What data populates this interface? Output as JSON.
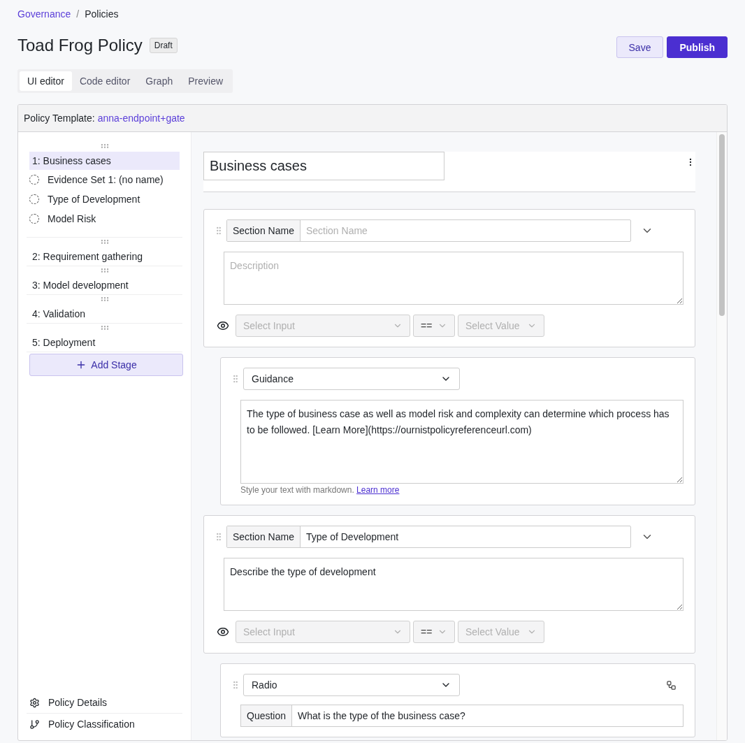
{
  "breadcrumb_separator": "/",
  "breadcrumb": [
    {
      "label": "Governance",
      "link": true
    },
    {
      "label": "Policies",
      "link": false
    }
  ],
  "title": "Toad Frog Policy",
  "status_badge": "Draft",
  "actions": [
    {
      "label": "Save",
      "kind": "secondary"
    },
    {
      "label": "Publish",
      "kind": "primary"
    }
  ],
  "tabs": [
    {
      "label": "UI editor",
      "selected": true
    },
    {
      "label": "Code editor",
      "selected": false
    },
    {
      "label": "Graph",
      "selected": false
    },
    {
      "label": "Preview",
      "selected": false
    }
  ],
  "template": {
    "label": "Policy Template:",
    "value": "anna-endpoint+gate"
  },
  "sidebar": {
    "stages": [
      {
        "label": "1: Business cases",
        "selected": true,
        "children": [
          {
            "label": "Evidence Set 1: (no name)"
          },
          {
            "label": "Type of Development"
          },
          {
            "label": "Model Risk"
          }
        ]
      },
      {
        "label": "2: Requirement gathering",
        "selected": false
      },
      {
        "label": "3: Model development",
        "selected": false
      },
      {
        "label": "4: Validation",
        "selected": false
      },
      {
        "label": "5: Deployment",
        "selected": false
      }
    ],
    "add_button": "Add Stage",
    "footer_links": [
      {
        "label": "Policy Details",
        "kind": "settings"
      },
      {
        "label": "Policy Classification",
        "kind": "branch"
      }
    ]
  },
  "editor": {
    "stage_title": "Business cases",
    "blocks": [
      {
        "kind": "section",
        "name_label": "Section Name",
        "name_placeholder": "Section Name",
        "description_placeholder": "Description",
        "condition": {
          "input_placeholder": "Select Input",
          "operator": "==",
          "value_placeholder": "Select Value"
        }
      },
      {
        "kind": "guidance",
        "type": "Guidance",
        "text": "The type of business case as well as model risk and complexity can determine which process has to be followed. [Learn More](https://ournistpolicyreferenceurl.com)",
        "hint": "Style your text with markdown.",
        "hint_link": "Learn more"
      },
      {
        "kind": "section",
        "name_label": "Section Name",
        "name_value": "Type of Development",
        "description_value": "Describe the type of development",
        "condition": {
          "input_placeholder": "Select Input",
          "operator": "==",
          "value_placeholder": "Select Value"
        }
      },
      {
        "kind": "question",
        "type": "Radio",
        "question_label": "Question",
        "question": "What is the type of the business case?"
      }
    ]
  }
}
